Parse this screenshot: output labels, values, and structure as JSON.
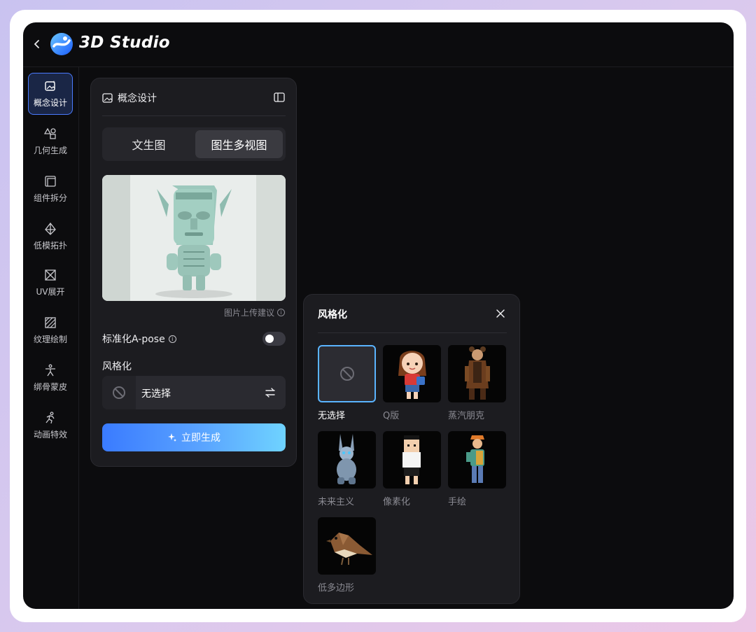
{
  "app": {
    "title": "3D Studio"
  },
  "sidebar": {
    "items": [
      {
        "label": "概念设计",
        "icon": "image-sparkle-icon",
        "active": true
      },
      {
        "label": "几何生成",
        "icon": "shapes-icon",
        "active": false
      },
      {
        "label": "组件拆分",
        "icon": "layers-split-icon",
        "active": false
      },
      {
        "label": "低模拓扑",
        "icon": "low-poly-icon",
        "active": false
      },
      {
        "label": "UV展开",
        "icon": "uv-unwrap-icon",
        "active": false
      },
      {
        "label": "纹理绘制",
        "icon": "texture-paint-icon",
        "active": false
      },
      {
        "label": "绑骨蒙皮",
        "icon": "rigging-icon",
        "active": false
      },
      {
        "label": "动画特效",
        "icon": "animation-icon",
        "active": false
      }
    ]
  },
  "panel": {
    "title": "概念设计",
    "tabs": [
      "文生图",
      "图生多视图"
    ],
    "active_tab": "图生多视图",
    "upload_tip": "图片上传建议",
    "apose_label": "标准化A-pose",
    "apose_enabled": false,
    "style_label": "风格化",
    "style_value": "无选择",
    "generate_label": "立即生成"
  },
  "style_popup": {
    "title": "风格化",
    "options": [
      {
        "label": "无选择",
        "selected": true
      },
      {
        "label": "Q版",
        "selected": false
      },
      {
        "label": "蒸汽朋克",
        "selected": false
      },
      {
        "label": "未来主义",
        "selected": false
      },
      {
        "label": "像素化",
        "selected": false
      },
      {
        "label": "手绘",
        "selected": false
      },
      {
        "label": "低多边形",
        "selected": false
      }
    ]
  },
  "colors": {
    "accent": "#4a7bff",
    "background": "#0c0c0e",
    "panel": "#1c1c20"
  }
}
